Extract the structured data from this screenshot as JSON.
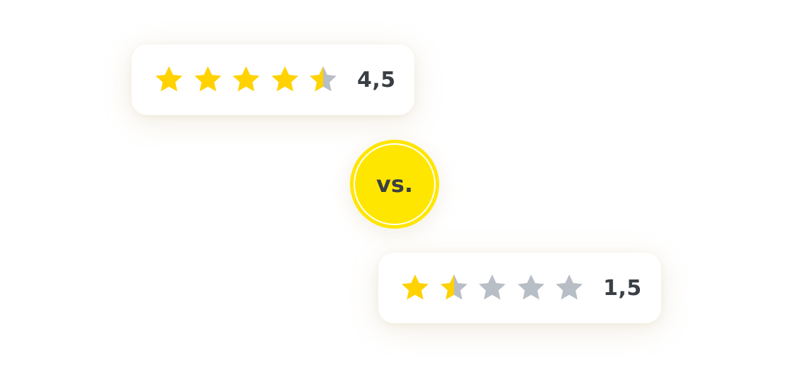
{
  "comparison": {
    "top_rating": {
      "value_text": "4,5",
      "score": 4.5,
      "max": 5
    },
    "separator_text": "vs.",
    "bottom_rating": {
      "value_text": "1,5",
      "score": 1.5,
      "max": 5
    }
  },
  "colors": {
    "star_filled": "#ffd200",
    "star_empty": "#b8bec6",
    "badge": "#ffe600",
    "text": "#3a3f45"
  },
  "icons": {
    "filled": "star-filled-icon",
    "half": "star-half-icon",
    "empty": "star-empty-icon"
  }
}
